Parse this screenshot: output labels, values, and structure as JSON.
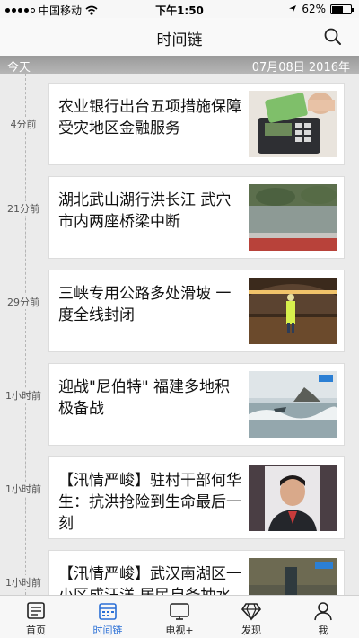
{
  "status_bar": {
    "carrier": "中国移动",
    "time": "下午1:50",
    "battery": "62%",
    "battery_level": 0.62
  },
  "nav": {
    "title": "时间链"
  },
  "date_strip": {
    "today": "今天",
    "date": "07月08日 2016年"
  },
  "timeline": {
    "items": [
      {
        "time": "4分前",
        "title": "农业银行出台五项措施保障受灾地区金融服务",
        "thumb_icon": "bank-card-machine-image"
      },
      {
        "time": "21分前",
        "title": "湖北武山湖行洪长江 武穴市内两座桥梁中断",
        "thumb_icon": "flooded-river-image"
      },
      {
        "time": "29分前",
        "title": "三峡专用公路多处滑坡 一度全线封闭",
        "thumb_icon": "worker-in-tunnel-image"
      },
      {
        "time": "1小时前",
        "title": "迎战\"尼伯特\" 福建多地积极备战",
        "thumb_icon": "storm-waves-image"
      },
      {
        "time": "1小时前",
        "title": "【汛情严峻】驻村干部何华生：抗洪抢险到生命最后一刻",
        "thumb_icon": "portrait-image"
      },
      {
        "time": "1小时前",
        "title": "【汛情严峻】武汉南湖区一小区成汪洋 居民自备抽水设施",
        "thumb_icon": "flooded-street-image"
      }
    ]
  },
  "tabs": [
    {
      "label": "首页",
      "icon": "home-news-icon",
      "active": false
    },
    {
      "label": "时间链",
      "icon": "calendar-icon",
      "active": true
    },
    {
      "label": "电视+",
      "icon": "tv-icon",
      "active": false
    },
    {
      "label": "发现",
      "icon": "diamond-icon",
      "active": false
    },
    {
      "label": "我",
      "icon": "user-icon",
      "active": false
    }
  ],
  "colors": {
    "accent": "#2a6fd6",
    "background": "#ebebeb",
    "date_strip": "#a6a6a6"
  }
}
